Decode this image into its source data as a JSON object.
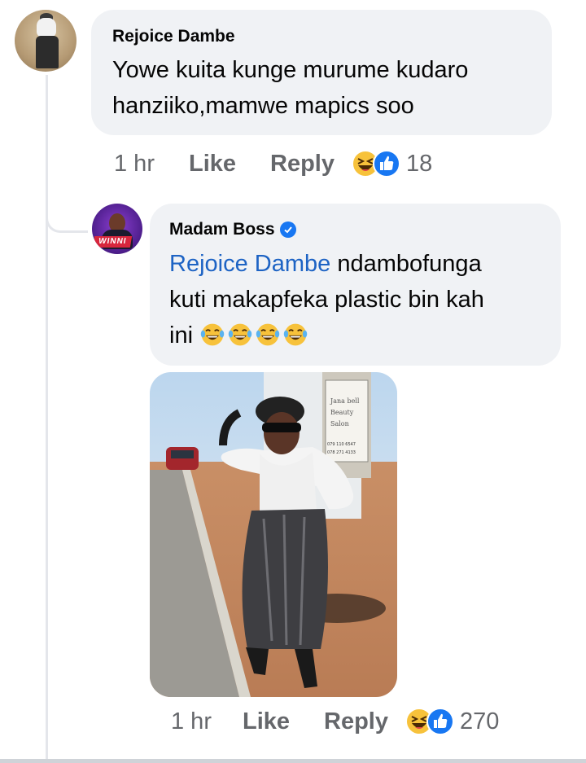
{
  "comment": {
    "author": "Rejoice Dambe",
    "text_line1": "Yowe kuita kunge murume kudaro",
    "text_line2": "hanziiko,mamwe mapics soo",
    "time": "1 hr",
    "like_label": "Like",
    "reply_label": "Reply",
    "reaction_icons": [
      "laughing-emoji-icon",
      "like-thumb-icon"
    ],
    "reaction_count": "18"
  },
  "reply": {
    "author": "Madam Boss",
    "verified_icon": "verified-badge-icon",
    "mention": "Rejoice Dambe",
    "text_part1": " ndambofunga",
    "text_line2": "kuti makapfeka plastic bin kah",
    "text_line3": "ini",
    "emoji_icons": [
      "tears-of-joy-icon",
      "tears-of-joy-icon",
      "tears-of-joy-icon",
      "tears-of-joy-icon"
    ],
    "photo_sign_lines": [
      "Jana bell",
      "Beauty",
      "Salon",
      "079 110 6547",
      "078 271 4133"
    ],
    "avatar_banner": "WINNI",
    "time": "1 hr",
    "like_label": "Like",
    "reply_label": "Reply",
    "reaction_icons": [
      "laughing-emoji-icon",
      "like-thumb-icon"
    ],
    "reaction_count": "270"
  },
  "colors": {
    "bubble": "#f0f2f5",
    "mention": "#1d63c4",
    "meta_text": "#65676b",
    "like_blue": "#1877f2",
    "emoji_yellow": "#f7c23b"
  }
}
